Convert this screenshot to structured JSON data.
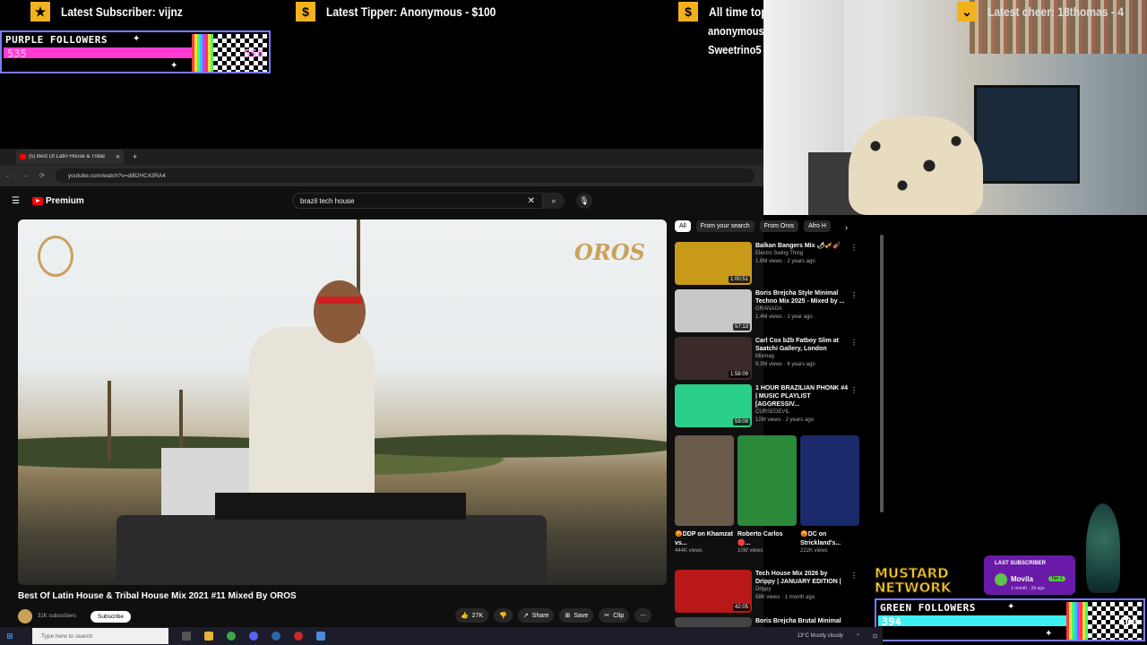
{
  "overlay": {
    "latest_subscriber": "Latest Subscriber: vijnz",
    "latest_tipper": "Latest Tipper: Anonymous - $100",
    "all_time_title": "All time top tip:",
    "all_time_list": [
      "anonymous - $100",
      "Sweetrino5 - $100"
    ],
    "latest_cheer": "Latest cheer: 18thomas - 4",
    "purple_goal": {
      "title": "PURPLE FOLLOWERS",
      "current": "535",
      "target": "550",
      "progress": 0.973
    },
    "green_goal": {
      "title": "GREEN FOLLOWERS",
      "current": "394",
      "target": "400",
      "progress": 0.985
    },
    "mustard_network": [
      "MUSTARD",
      "NETWORK"
    ],
    "last_subscriber": {
      "label": "LAST SUBSCRIBER",
      "name": "Movila",
      "tier": "Tier 1",
      "meta": "1 month · 2d ago"
    },
    "colors": {
      "purple_bar": "#ff3bd2",
      "green_bar": "#3ff0f0",
      "mustard": "#ffd23a"
    }
  },
  "browser": {
    "tab_title": "(5) Best Of Latin House & Tribal",
    "url": "youtube.com/watch?v=diB2HC43RA4"
  },
  "youtube": {
    "logo": "Premium",
    "search_query": "brazil tech house",
    "video_title": "Best Of Latin House & Tribal House Mix 2021 #11 Mixed By OROS",
    "channel_subs": "31K subscribers",
    "subscribe_label": "Subscribe",
    "video_brand": "OROS",
    "actions": {
      "likes": "27K",
      "share": "Share",
      "save": "Save",
      "clip": "Clip"
    },
    "chips": [
      "All",
      "From your search",
      "From Oros",
      "Afro H"
    ],
    "sidebar": [
      {
        "title": "Balkan Bangers Mix 🌶🎺🎻",
        "channel": "Electro Swing Thing",
        "meta": "1.6M views · 2 years ago",
        "duration": "1:00:51",
        "color": "#c89a1a"
      },
      {
        "title": "Boris Brejcha Style Minimal Techno Mix 2025 - Mixed by ...",
        "channel": "GRANADA",
        "meta": "1.4M views · 1 year ago",
        "duration": "57:13",
        "color": "#c8c8c8"
      },
      {
        "title": "Carl Cox b2b Fatboy Slim at Saatchi Gallery, London",
        "channel": "Mixmag",
        "meta": "9.3M views · 6 years ago",
        "duration": "1:58:09",
        "color": "#3a2a2a"
      },
      {
        "title": "1 HOUR BRAZILIAN PHONK #4 | MUSIC PLAYLIST [AGGRESSIV...",
        "channel": "CURSEDEVIL",
        "meta": "12M views · 2 years ago",
        "duration": "59:09",
        "color": "#2ad08a"
      },
      {
        "title": "Tech House Mix 2026 by Drippy | JANUARY EDITION |",
        "channel": "Drippy",
        "meta": "58K views · 1 month ago",
        "duration": "42:05",
        "color": "#b81818"
      },
      {
        "title": "Boris Brejcha Brutal Minimal",
        "channel": "",
        "meta": "",
        "duration": "",
        "color": "#444"
      }
    ],
    "shorts": [
      {
        "title": "😡DDP on Khamzat vs...",
        "views": "444K views",
        "color": "#6a5a4a"
      },
      {
        "title": "Roberto Carlos 🔴...",
        "views": "10M views",
        "color": "#2a8a3a"
      },
      {
        "title": "😡DC on Strickland's...",
        "views": "222K views",
        "color": "#1a2a6a"
      }
    ]
  },
  "taskbar": {
    "search_placeholder": "Type here to search",
    "weather": "13°C  Mostly cloudy"
  }
}
